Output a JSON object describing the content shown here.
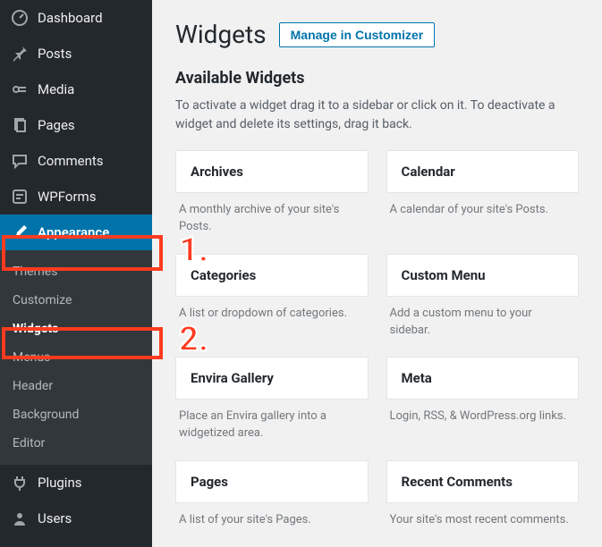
{
  "sidebar": {
    "items": [
      {
        "label": "Dashboard",
        "icon": "dashboard"
      },
      {
        "label": "Posts",
        "icon": "pin"
      },
      {
        "label": "Media",
        "icon": "media"
      },
      {
        "label": "Pages",
        "icon": "pages"
      },
      {
        "label": "Comments",
        "icon": "comments"
      },
      {
        "label": "WPForms",
        "icon": "wpforms"
      },
      {
        "label": "Appearance",
        "icon": "brush",
        "current": true
      },
      {
        "label": "Plugins",
        "icon": "plug"
      },
      {
        "label": "Users",
        "icon": "users"
      }
    ],
    "appearance_sub": [
      {
        "label": "Themes"
      },
      {
        "label": "Customize"
      },
      {
        "label": "Widgets",
        "current": true
      },
      {
        "label": "Menus"
      },
      {
        "label": "Header"
      },
      {
        "label": "Background"
      },
      {
        "label": "Editor"
      }
    ]
  },
  "page": {
    "title": "Widgets",
    "manage_label": "Manage in Customizer",
    "available_title": "Available Widgets",
    "available_desc": "To activate a widget drag it to a sidebar or click on it. To deactivate a widget and delete its settings, drag it back."
  },
  "widgets": [
    {
      "title": "Archives",
      "desc": "A monthly archive of your site's Posts."
    },
    {
      "title": "Calendar",
      "desc": "A calendar of your site's Posts."
    },
    {
      "title": "Categories",
      "desc": "A list or dropdown of categories."
    },
    {
      "title": "Custom Menu",
      "desc": "Add a custom menu to your sidebar."
    },
    {
      "title": "Envira Gallery",
      "desc": "Place an Envira gallery into a widgetized area."
    },
    {
      "title": "Meta",
      "desc": "Login, RSS, & WordPress.org links."
    },
    {
      "title": "Pages",
      "desc": "A list of your site's Pages."
    },
    {
      "title": "Recent Comments",
      "desc": "Your site's most recent comments."
    }
  ],
  "annotations": {
    "one": "1.",
    "two": "2."
  }
}
